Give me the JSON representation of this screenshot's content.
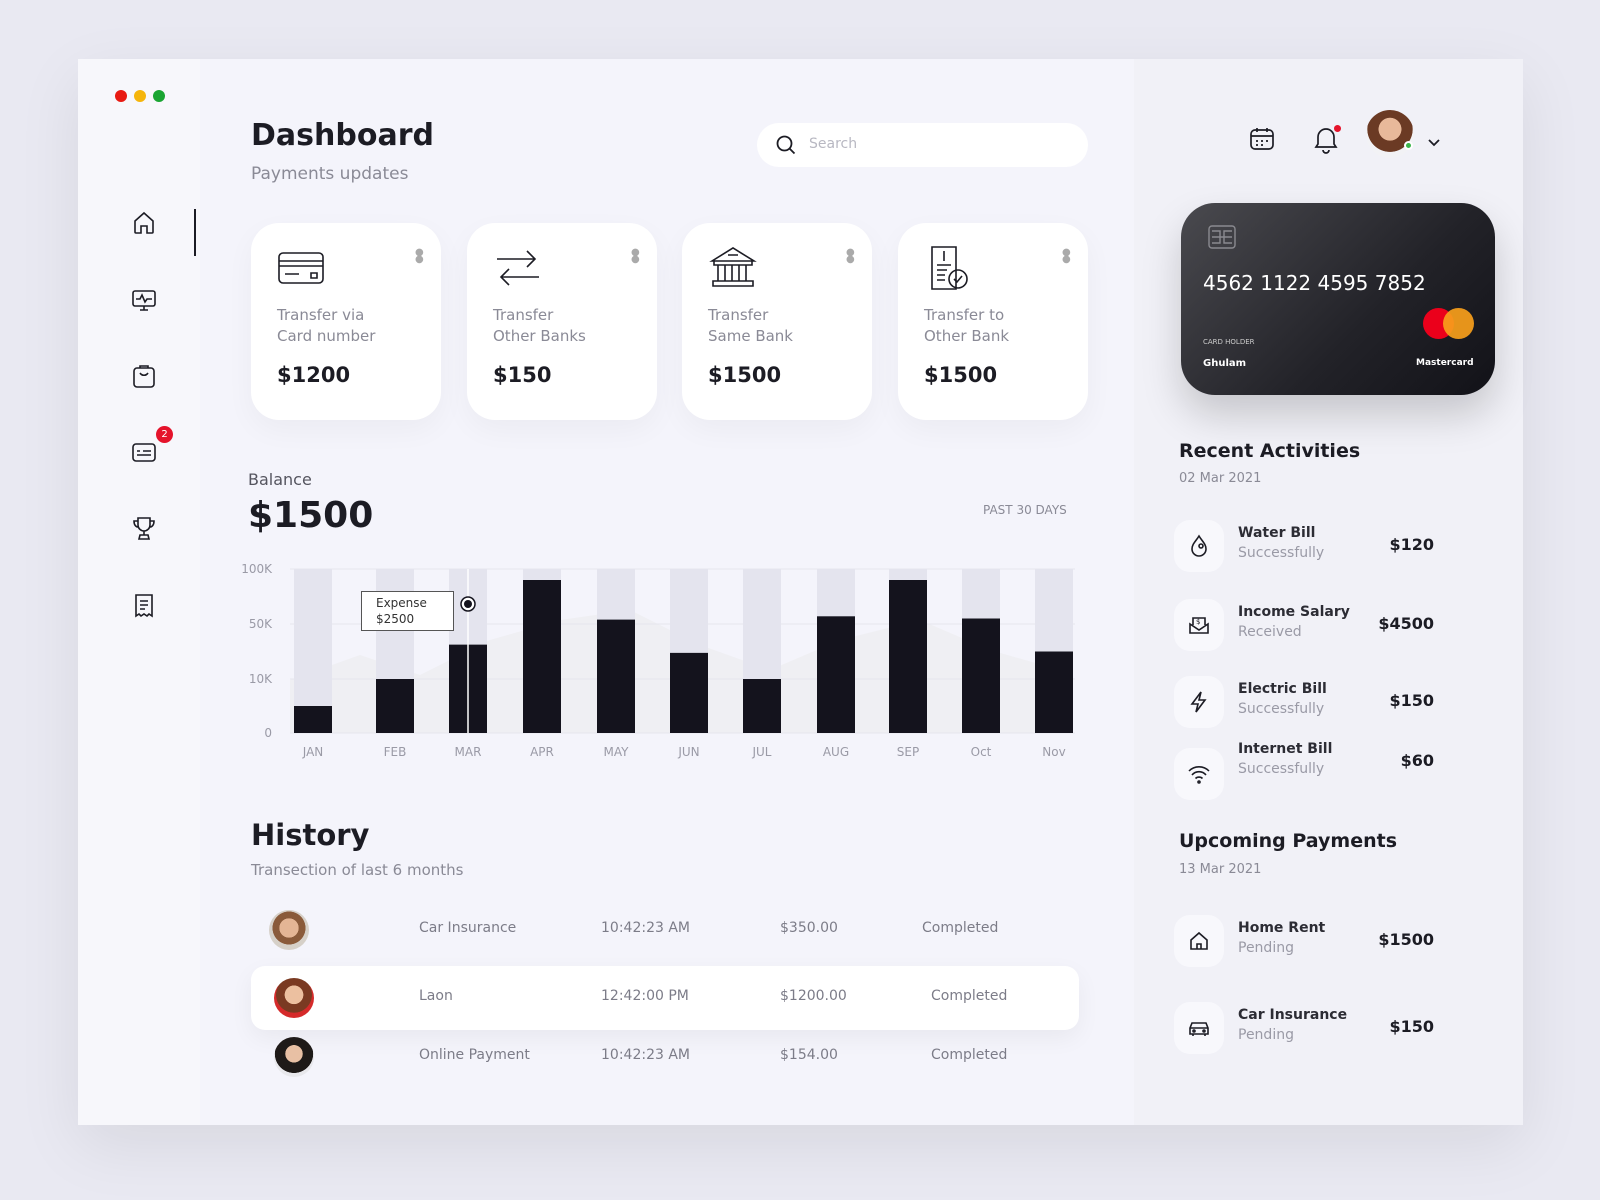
{
  "header": {
    "title": "Dashboard",
    "subtitle": "Payments updates",
    "search_placeholder": "Search"
  },
  "sidebar": {
    "items": [
      "home",
      "monitor",
      "clipboard",
      "messages",
      "trophy",
      "receipt"
    ],
    "badge": "2"
  },
  "colors": {
    "accent": "#14131d",
    "badge": "#e5132b",
    "close": "#e81a12",
    "minimize": "#f5b50b",
    "maximize": "#1aa532"
  },
  "cards": [
    {
      "icon": "credit-card-icon",
      "line1": "Transfer via",
      "line2": "Card number",
      "amount": "$1200"
    },
    {
      "icon": "transfer-arrows-icon",
      "line1": "Transfer",
      "line2": "Other Banks",
      "amount": "$150"
    },
    {
      "icon": "bank-icon",
      "line1": "Transfer",
      "line2": "Same Bank",
      "amount": "$1500"
    },
    {
      "icon": "invoice-icon",
      "line1": "Transfer to",
      "line2": "Other Bank",
      "amount": "$1500"
    }
  ],
  "balance": {
    "label": "Balance",
    "amount": "$1500",
    "period": "PAST 30 DAYS"
  },
  "chart_data": {
    "type": "bar",
    "categories": [
      "JAN",
      "FEB",
      "MAR",
      "APR",
      "MAY",
      "JUN",
      "JUL",
      "AUG",
      "SEP",
      "Oct",
      "Nov"
    ],
    "values": [
      5000,
      10000,
      35000,
      90000,
      54000,
      29000,
      10000,
      57000,
      90000,
      55000,
      30000
    ],
    "yticks": [
      "0",
      "10K",
      "50K",
      "100K"
    ],
    "ytick_values": [
      0,
      10000,
      50000,
      100000
    ],
    "ylim": [
      0,
      100000
    ],
    "tooltip": {
      "category": "MAR",
      "label": "Expense",
      "value": "$2500"
    }
  },
  "history": {
    "title": "History",
    "subtitle": "Transection of last 6 months",
    "rows": [
      {
        "name": "Car Insurance",
        "time": "10:42:23 AM",
        "amount": "$350.00",
        "status": "Completed"
      },
      {
        "name": "Laon",
        "time": "12:42:00 PM",
        "amount": "$1200.00",
        "status": "Completed"
      },
      {
        "name": "Online Payment",
        "time": "10:42:23 AM",
        "amount": "$154.00",
        "status": "Completed"
      }
    ]
  },
  "bank_card": {
    "number": "4562 1122 4595 7852",
    "holder_label": "CARD HOLDER",
    "holder": "Ghulam",
    "brand": "Mastercard"
  },
  "recent": {
    "title": "Recent Activities",
    "date": "02 Mar 2021",
    "items": [
      {
        "name": "Water Bill",
        "status": "Successfully",
        "amount": "$120"
      },
      {
        "name": "Income Salary",
        "status": "Received",
        "amount": "$4500"
      },
      {
        "name": "Electric Bill",
        "status": "Successfully",
        "amount": "$150"
      },
      {
        "name": "Internet Bill",
        "status": "Successfully",
        "amount": "$60"
      }
    ]
  },
  "upcoming": {
    "title": "Upcoming Payments",
    "date": "13 Mar 2021",
    "items": [
      {
        "name": "Home Rent",
        "status": "Pending",
        "amount": "$1500"
      },
      {
        "name": "Car Insurance",
        "status": "Pending",
        "amount": "$150"
      }
    ]
  }
}
